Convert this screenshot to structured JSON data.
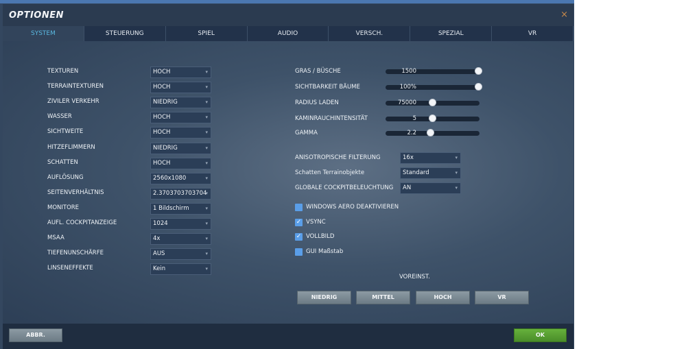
{
  "window": {
    "title": "OPTIONEN",
    "close": "×"
  },
  "tabs": [
    "SYSTEM",
    "STEUERUNG",
    "SPIEL",
    "AUDIO",
    "VERSCH.",
    "SPEZIAL",
    "VR"
  ],
  "left_settings": [
    {
      "label": "TEXTUREN",
      "value": "HOCH"
    },
    {
      "label": "TERRAINTEXTUREN",
      "value": "HOCH"
    },
    {
      "label": "ZIVILER VERKEHR",
      "value": "NIEDRIG"
    },
    {
      "label": "WASSER",
      "value": "HOCH"
    },
    {
      "label": "SICHTWEITE",
      "value": "HOCH"
    },
    {
      "label": "HITZEFLIMMERN",
      "value": "NIEDRIG"
    },
    {
      "label": "SCHATTEN",
      "value": "HOCH"
    },
    {
      "label": "AUFLÖSUNG",
      "value": "2560x1080"
    },
    {
      "label": "SEITENVERHÄLTNIS",
      "value": "2.3703703703704"
    },
    {
      "label": "MONITORE",
      "value": "1 Bildschirm"
    },
    {
      "label": "AUFL. COCKPITANZEIGE",
      "value": "1024"
    },
    {
      "label": "MSAA",
      "value": "4x"
    },
    {
      "label": "TIEFENUNSCHÄRFE",
      "value": "AUS"
    },
    {
      "label": "LINSENEFFEKTE",
      "value": "Kein"
    }
  ],
  "sliders": [
    {
      "label": "GRAS / BÜSCHE",
      "value": "1500",
      "fraction": 1.0
    },
    {
      "label": "SICHTBARKEIT BÄUME",
      "value": "100%",
      "fraction": 1.0
    },
    {
      "label": "RADIUS LADEN",
      "value": "75000",
      "fraction": 0.5
    },
    {
      "label": "KAMINRAUCHINTENSITÄT",
      "value": "5",
      "fraction": 0.5
    },
    {
      "label": "GAMMA",
      "value": "2.2",
      "fraction": 0.48
    }
  ],
  "right_dropdowns": [
    {
      "label": "ANISOTROPISCHE FILTERUNG",
      "value": "16x"
    },
    {
      "label": "Schatten Terrainobjekte",
      "value": "Standard"
    },
    {
      "label": "GLOBALE COCKPITBELEUCHTUNG",
      "value": "AN"
    }
  ],
  "checkboxes": [
    {
      "label": "WINDOWS AERO DEAKTIVIEREN",
      "checked": false
    },
    {
      "label": "VSYNC",
      "checked": true
    },
    {
      "label": "VOLLBILD",
      "checked": true
    },
    {
      "label": "GUI Maßstab",
      "checked": false
    }
  ],
  "presets": {
    "label": "VOREINST.",
    "buttons": [
      "NIEDRIG",
      "MITTEL",
      "HOCH",
      "VR"
    ]
  },
  "footer": {
    "cancel": "ABBR.",
    "ok": "OK"
  }
}
